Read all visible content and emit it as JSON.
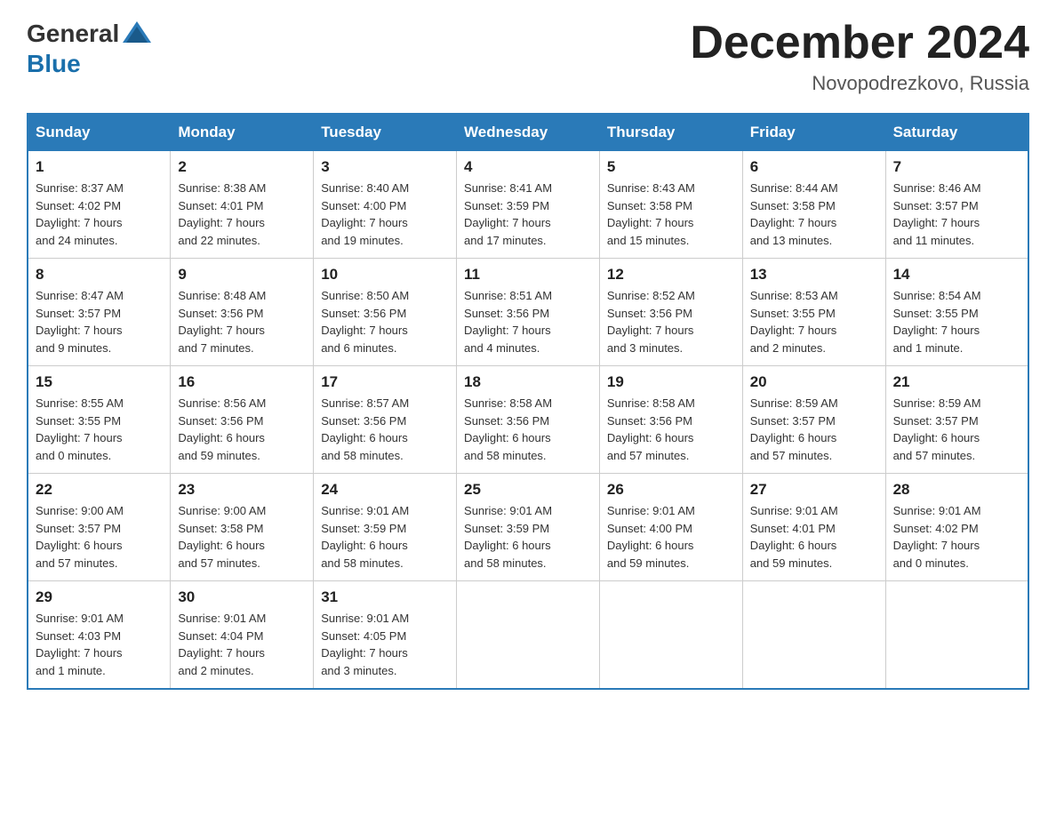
{
  "header": {
    "logo_general": "General",
    "logo_blue": "Blue",
    "title": "December 2024",
    "location": "Novopodrezkovo, Russia"
  },
  "days_of_week": [
    "Sunday",
    "Monday",
    "Tuesday",
    "Wednesday",
    "Thursday",
    "Friday",
    "Saturday"
  ],
  "weeks": [
    [
      {
        "num": "1",
        "sunrise": "8:37 AM",
        "sunset": "4:02 PM",
        "daylight": "7 hours",
        "daylight2": "and 24 minutes."
      },
      {
        "num": "2",
        "sunrise": "8:38 AM",
        "sunset": "4:01 PM",
        "daylight": "7 hours",
        "daylight2": "and 22 minutes."
      },
      {
        "num": "3",
        "sunrise": "8:40 AM",
        "sunset": "4:00 PM",
        "daylight": "7 hours",
        "daylight2": "and 19 minutes."
      },
      {
        "num": "4",
        "sunrise": "8:41 AM",
        "sunset": "3:59 PM",
        "daylight": "7 hours",
        "daylight2": "and 17 minutes."
      },
      {
        "num": "5",
        "sunrise": "8:43 AM",
        "sunset": "3:58 PM",
        "daylight": "7 hours",
        "daylight2": "and 15 minutes."
      },
      {
        "num": "6",
        "sunrise": "8:44 AM",
        "sunset": "3:58 PM",
        "daylight": "7 hours",
        "daylight2": "and 13 minutes."
      },
      {
        "num": "7",
        "sunrise": "8:46 AM",
        "sunset": "3:57 PM",
        "daylight": "7 hours",
        "daylight2": "and 11 minutes."
      }
    ],
    [
      {
        "num": "8",
        "sunrise": "8:47 AM",
        "sunset": "3:57 PM",
        "daylight": "7 hours",
        "daylight2": "and 9 minutes."
      },
      {
        "num": "9",
        "sunrise": "8:48 AM",
        "sunset": "3:56 PM",
        "daylight": "7 hours",
        "daylight2": "and 7 minutes."
      },
      {
        "num": "10",
        "sunrise": "8:50 AM",
        "sunset": "3:56 PM",
        "daylight": "7 hours",
        "daylight2": "and 6 minutes."
      },
      {
        "num": "11",
        "sunrise": "8:51 AM",
        "sunset": "3:56 PM",
        "daylight": "7 hours",
        "daylight2": "and 4 minutes."
      },
      {
        "num": "12",
        "sunrise": "8:52 AM",
        "sunset": "3:56 PM",
        "daylight": "7 hours",
        "daylight2": "and 3 minutes."
      },
      {
        "num": "13",
        "sunrise": "8:53 AM",
        "sunset": "3:55 PM",
        "daylight": "7 hours",
        "daylight2": "and 2 minutes."
      },
      {
        "num": "14",
        "sunrise": "8:54 AM",
        "sunset": "3:55 PM",
        "daylight": "7 hours",
        "daylight2": "and 1 minute."
      }
    ],
    [
      {
        "num": "15",
        "sunrise": "8:55 AM",
        "sunset": "3:55 PM",
        "daylight": "7 hours",
        "daylight2": "and 0 minutes."
      },
      {
        "num": "16",
        "sunrise": "8:56 AM",
        "sunset": "3:56 PM",
        "daylight": "6 hours",
        "daylight2": "and 59 minutes."
      },
      {
        "num": "17",
        "sunrise": "8:57 AM",
        "sunset": "3:56 PM",
        "daylight": "6 hours",
        "daylight2": "and 58 minutes."
      },
      {
        "num": "18",
        "sunrise": "8:58 AM",
        "sunset": "3:56 PM",
        "daylight": "6 hours",
        "daylight2": "and 58 minutes."
      },
      {
        "num": "19",
        "sunrise": "8:58 AM",
        "sunset": "3:56 PM",
        "daylight": "6 hours",
        "daylight2": "and 57 minutes."
      },
      {
        "num": "20",
        "sunrise": "8:59 AM",
        "sunset": "3:57 PM",
        "daylight": "6 hours",
        "daylight2": "and 57 minutes."
      },
      {
        "num": "21",
        "sunrise": "8:59 AM",
        "sunset": "3:57 PM",
        "daylight": "6 hours",
        "daylight2": "and 57 minutes."
      }
    ],
    [
      {
        "num": "22",
        "sunrise": "9:00 AM",
        "sunset": "3:57 PM",
        "daylight": "6 hours",
        "daylight2": "and 57 minutes."
      },
      {
        "num": "23",
        "sunrise": "9:00 AM",
        "sunset": "3:58 PM",
        "daylight": "6 hours",
        "daylight2": "and 57 minutes."
      },
      {
        "num": "24",
        "sunrise": "9:01 AM",
        "sunset": "3:59 PM",
        "daylight": "6 hours",
        "daylight2": "and 58 minutes."
      },
      {
        "num": "25",
        "sunrise": "9:01 AM",
        "sunset": "3:59 PM",
        "daylight": "6 hours",
        "daylight2": "and 58 minutes."
      },
      {
        "num": "26",
        "sunrise": "9:01 AM",
        "sunset": "4:00 PM",
        "daylight": "6 hours",
        "daylight2": "and 59 minutes."
      },
      {
        "num": "27",
        "sunrise": "9:01 AM",
        "sunset": "4:01 PM",
        "daylight": "6 hours",
        "daylight2": "and 59 minutes."
      },
      {
        "num": "28",
        "sunrise": "9:01 AM",
        "sunset": "4:02 PM",
        "daylight": "7 hours",
        "daylight2": "and 0 minutes."
      }
    ],
    [
      {
        "num": "29",
        "sunrise": "9:01 AM",
        "sunset": "4:03 PM",
        "daylight": "7 hours",
        "daylight2": "and 1 minute."
      },
      {
        "num": "30",
        "sunrise": "9:01 AM",
        "sunset": "4:04 PM",
        "daylight": "7 hours",
        "daylight2": "and 2 minutes."
      },
      {
        "num": "31",
        "sunrise": "9:01 AM",
        "sunset": "4:05 PM",
        "daylight": "7 hours",
        "daylight2": "and 3 minutes."
      },
      null,
      null,
      null,
      null
    ]
  ],
  "labels": {
    "sunrise": "Sunrise:",
    "sunset": "Sunset:",
    "daylight": "Daylight:"
  }
}
